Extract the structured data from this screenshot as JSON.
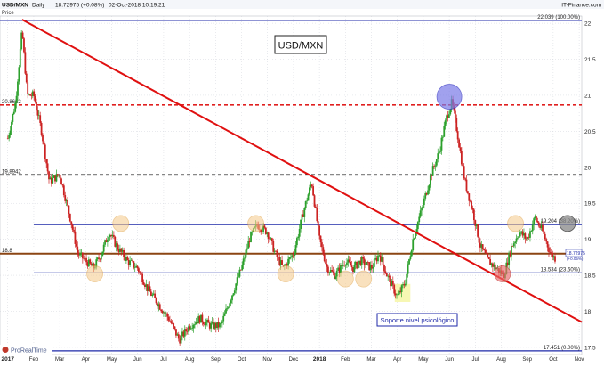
{
  "header": {
    "symbol": "USD/MXN",
    "interval": "Daily",
    "quote": "18.72975 (+0.08%)",
    "datetime": "02-Oct-2018 10:19:21",
    "provider": "IT-Finance.com",
    "price_label": "Price"
  },
  "footer": {
    "brand": "ProRealTime"
  },
  "colors": {
    "up_candle": "#2ca02c",
    "down_candle": "#cc2222",
    "blue_lines": "#1f2aa8",
    "red_line": "#e01010",
    "dashed_red": "#e02020",
    "dashed_black": "#111111",
    "brown_line": "#8b4513",
    "grid": "#c8ccd4"
  },
  "chart_data": {
    "type": "candlestick",
    "title": "USD/MXN",
    "ylim": [
      17.4,
      22.1
    ],
    "y_ticks": [
      17.5,
      18,
      18.5,
      19,
      19.5,
      20,
      20.5,
      21,
      21.5,
      22
    ],
    "x_ticks": [
      "2017",
      "Feb",
      "Mar",
      "Apr",
      "May",
      "Jun",
      "Jul",
      "Aug",
      "Sep",
      "Oct",
      "Nov",
      "Dec",
      "2018",
      "Feb",
      "Mar",
      "Apr",
      "May",
      "Jun",
      "Jul",
      "Aug",
      "Sep",
      "Oct",
      "Nov"
    ],
    "x_tick_months": [
      0,
      1,
      2,
      3,
      4,
      5,
      6,
      7,
      8,
      9,
      10,
      11,
      12,
      13,
      14,
      15,
      16,
      17,
      18,
      19,
      20,
      21,
      22
    ],
    "xlim_months": [
      -0.3,
      22.1
    ],
    "price_path": [
      {
        "m": 0.0,
        "v": 20.4
      },
      {
        "m": 0.3,
        "v": 20.9
      },
      {
        "m": 0.55,
        "v": 21.9
      },
      {
        "m": 0.75,
        "v": 21.0
      },
      {
        "m": 1.0,
        "v": 21.0
      },
      {
        "m": 1.3,
        "v": 20.5
      },
      {
        "m": 1.6,
        "v": 19.8
      },
      {
        "m": 2.0,
        "v": 19.9
      },
      {
        "m": 2.4,
        "v": 19.3
      },
      {
        "m": 2.7,
        "v": 18.8
      },
      {
        "m": 3.0,
        "v": 18.7
      },
      {
        "m": 3.3,
        "v": 18.6
      },
      {
        "m": 3.6,
        "v": 18.8
      },
      {
        "m": 3.9,
        "v": 19.1
      },
      {
        "m": 4.2,
        "v": 18.9
      },
      {
        "m": 4.6,
        "v": 18.7
      },
      {
        "m": 5.0,
        "v": 18.6
      },
      {
        "m": 5.4,
        "v": 18.3
      },
      {
        "m": 5.8,
        "v": 18.1
      },
      {
        "m": 6.2,
        "v": 17.9
      },
      {
        "m": 6.6,
        "v": 17.6
      },
      {
        "m": 7.0,
        "v": 17.8
      },
      {
        "m": 7.4,
        "v": 17.9
      },
      {
        "m": 7.8,
        "v": 17.8
      },
      {
        "m": 8.2,
        "v": 17.8
      },
      {
        "m": 8.6,
        "v": 18.2
      },
      {
        "m": 9.0,
        "v": 18.6
      },
      {
        "m": 9.3,
        "v": 19.0
      },
      {
        "m": 9.6,
        "v": 19.2
      },
      {
        "m": 10.0,
        "v": 19.1
      },
      {
        "m": 10.3,
        "v": 18.8
      },
      {
        "m": 10.6,
        "v": 18.6
      },
      {
        "m": 11.0,
        "v": 18.8
      },
      {
        "m": 11.4,
        "v": 19.4
      },
      {
        "m": 11.7,
        "v": 19.8
      },
      {
        "m": 12.0,
        "v": 19.0
      },
      {
        "m": 12.3,
        "v": 18.6
      },
      {
        "m": 12.6,
        "v": 18.5
      },
      {
        "m": 13.0,
        "v": 18.7
      },
      {
        "m": 13.3,
        "v": 18.6
      },
      {
        "m": 13.6,
        "v": 18.7
      },
      {
        "m": 14.0,
        "v": 18.6
      },
      {
        "m": 14.3,
        "v": 18.8
      },
      {
        "m": 14.6,
        "v": 18.5
      },
      {
        "m": 15.0,
        "v": 18.2
      },
      {
        "m": 15.3,
        "v": 18.4
      },
      {
        "m": 15.6,
        "v": 19.0
      },
      {
        "m": 16.0,
        "v": 19.5
      },
      {
        "m": 16.3,
        "v": 19.9
      },
      {
        "m": 16.6,
        "v": 20.2
      },
      {
        "m": 16.9,
        "v": 20.7
      },
      {
        "m": 17.1,
        "v": 20.9
      },
      {
        "m": 17.3,
        "v": 20.5
      },
      {
        "m": 17.6,
        "v": 19.8
      },
      {
        "m": 17.9,
        "v": 19.4
      },
      {
        "m": 18.2,
        "v": 18.9
      },
      {
        "m": 18.5,
        "v": 18.7
      },
      {
        "m": 18.8,
        "v": 18.6
      },
      {
        "m": 19.1,
        "v": 18.5
      },
      {
        "m": 19.4,
        "v": 18.9
      },
      {
        "m": 19.7,
        "v": 19.1
      },
      {
        "m": 20.0,
        "v": 19.0
      },
      {
        "m": 20.3,
        "v": 19.3
      },
      {
        "m": 20.6,
        "v": 19.1
      },
      {
        "m": 20.9,
        "v": 18.8
      },
      {
        "m": 21.1,
        "v": 18.73
      }
    ],
    "hlines": [
      {
        "name": "top",
        "value": 22.039,
        "label": "22.039 (100.00%)",
        "style": "solid",
        "color": "#1f2aa8"
      },
      {
        "name": "r2",
        "value": 20.865,
        "label": "20.8652",
        "style": "dashed",
        "color": "#e02020"
      },
      {
        "name": "r1",
        "value": 19.894,
        "label": "19.8942",
        "style": "dashed",
        "color": "#111111"
      },
      {
        "name": "fib38",
        "value": 19.204,
        "label": "19.204 (38.20%)",
        "style": "solid",
        "color": "#1f2aa8"
      },
      {
        "name": "pivot",
        "value": 18.8,
        "label": "18.8",
        "style": "solid",
        "color": "#8b4513"
      },
      {
        "name": "fib23",
        "value": 18.534,
        "label": "18.534 (23.60%)",
        "style": "solid",
        "color": "#1f2aa8"
      },
      {
        "name": "bottom",
        "value": 17.451,
        "label": "17.451 (0.00%)",
        "style": "solid",
        "color": "#1f2aa8"
      }
    ],
    "trendline": {
      "from": {
        "m": 0.55,
        "v": 22.05
      },
      "to": {
        "m": 22.1,
        "v": 17.85
      }
    },
    "current_price": {
      "value": 18.72975,
      "label": "18.72975",
      "sub": "(+0.05%)"
    },
    "annotation": "Soporte nivel psicológico",
    "highlight_circles": [
      {
        "m": 3.35,
        "v": 18.52,
        "color": "orange"
      },
      {
        "m": 4.35,
        "v": 19.22,
        "color": "orange"
      },
      {
        "m": 9.55,
        "v": 19.22,
        "color": "orange"
      },
      {
        "m": 10.7,
        "v": 18.52,
        "color": "orange"
      },
      {
        "m": 13.0,
        "v": 18.45,
        "color": "orange"
      },
      {
        "m": 13.7,
        "v": 18.45,
        "color": "orange"
      },
      {
        "m": 19.55,
        "v": 19.22,
        "color": "orange"
      },
      {
        "m": 19.05,
        "v": 18.52,
        "color": "red"
      },
      {
        "m": 17.0,
        "v": 20.98,
        "color": "blue"
      },
      {
        "m": 21.55,
        "v": 19.22,
        "color": "gray"
      }
    ],
    "highlight_box": {
      "m0": 14.9,
      "m1": 15.5,
      "v0": 18.13,
      "v1": 18.38
    }
  }
}
